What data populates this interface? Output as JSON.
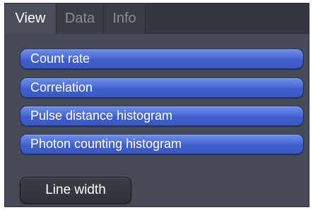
{
  "tabs": [
    {
      "label": "View",
      "active": true
    },
    {
      "label": "Data",
      "active": false
    },
    {
      "label": "Info",
      "active": false
    }
  ],
  "view": {
    "buttons": [
      {
        "label": "Count rate"
      },
      {
        "label": "Correlation"
      },
      {
        "label": "Pulse distance histogram"
      },
      {
        "label": "Photon counting histogram"
      }
    ],
    "line_width_label": "Line width"
  },
  "colors": {
    "panel_background": "#464b56",
    "tabbar_background": "#34373f",
    "active_tab": "#4a4f5b",
    "button_blue": "#4b6bd8",
    "button_border": "#1d2f73",
    "dark_button": "#2f323a"
  }
}
